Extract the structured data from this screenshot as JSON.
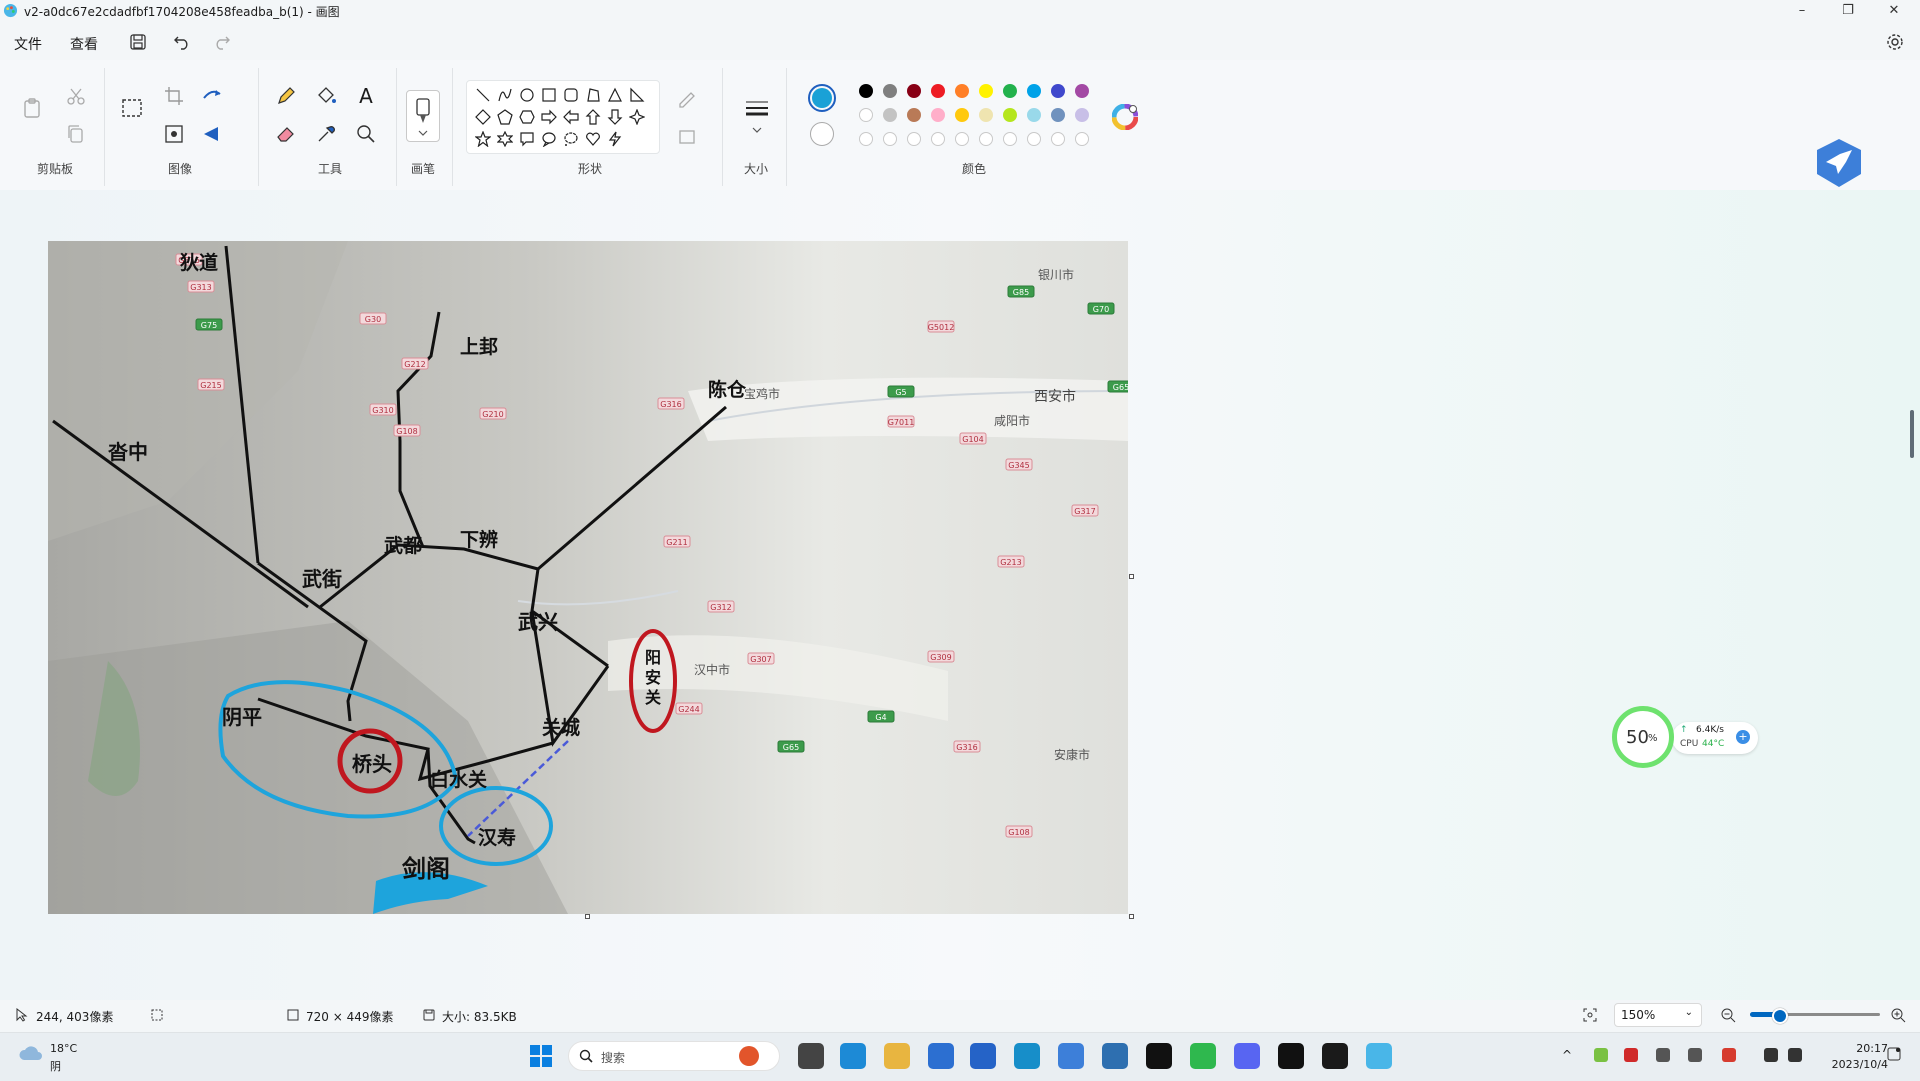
{
  "window": {
    "title": "v2-a0dc67e2cdadfbf1704208e458feadba_b(1) - 画图",
    "minimize": "–",
    "maximize": "❐",
    "close": "✕"
  },
  "menu": {
    "file": "文件",
    "view": "查看"
  },
  "ribbon": {
    "groups": {
      "clipboard": "剪贴板",
      "image": "图像",
      "tools": "工具",
      "brush": "画笔",
      "shapes": "形状",
      "size": "大小",
      "colors": "颜色"
    },
    "text_tool": "A"
  },
  "colors": {
    "primary": "#1aa1d6",
    "secondary": "#ffffff",
    "row1": [
      "#000000",
      "#7f7f7f",
      "#880015",
      "#ed1c24",
      "#ff7f27",
      "#fff200",
      "#22b14c",
      "#00a2e8",
      "#3f48cc",
      "#a349a4"
    ],
    "row2": [
      "#ffffff",
      "#c3c3c3",
      "#b97a57",
      "#ffaec9",
      "#ffc90e",
      "#efe4b0",
      "#b5e61d",
      "#99d9ea",
      "#7092be",
      "#c8bfe7"
    ]
  },
  "map": {
    "places": {
      "didao": "狄道",
      "shanggui": "上邽",
      "chencang": "陈仓",
      "tazhong": "沓中",
      "wudu": "武都",
      "xiabian": "下辨",
      "wujie": "武街",
      "wuxing": "武兴",
      "yangan": "阳安关",
      "yinping": "阴平",
      "qiaotou": "桥头",
      "guancheng": "关城",
      "baishuiguan": "白水关",
      "hanshou": "汉寿",
      "jiange": "剑阁"
    },
    "base_labels": {
      "yinchuan": "银川市",
      "xian": "西安市",
      "xianyang": "咸阳市",
      "baoji": "宝鸡市",
      "hanzhong": "汉中市",
      "ankang": "安康市"
    },
    "road_shields": [
      "G316",
      "G313",
      "G75",
      "G30",
      "G212",
      "G215",
      "G310",
      "G108",
      "G210",
      "G316",
      "G5",
      "G85",
      "G70",
      "G65",
      "G5012",
      "G7011",
      "G104",
      "G345",
      "G317",
      "G211",
      "G312",
      "G244",
      "G307",
      "G309",
      "G213",
      "G65",
      "G4",
      "G316",
      "G108"
    ]
  },
  "status": {
    "cursor": "244, 403像素",
    "selection": "720 × 449像素",
    "size": "大小: 83.5KB",
    "zoom": "150%"
  },
  "widget": {
    "percent": "50",
    "percent_unit": "%",
    "net": "6.4K/s",
    "cpu_label": "CPU",
    "cpu_temp": "44°C"
  },
  "taskbar": {
    "search_placeholder": "搜索",
    "weather_temp": "18°C",
    "weather_desc": "阴",
    "time": "20:17",
    "date": "2023/10/4"
  }
}
